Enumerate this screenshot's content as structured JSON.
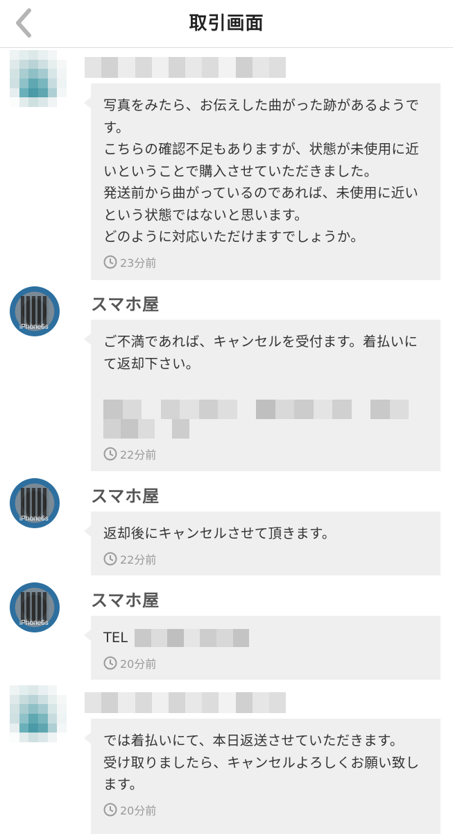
{
  "header": {
    "title": "取引画面",
    "back_icon": "chevron-left-icon"
  },
  "colors": {
    "bubble": "#efefef",
    "time": "#999999",
    "name": "#555555"
  },
  "messages": [
    {
      "sender": "",
      "text": "写真をみたら、お伝えした曲がった跡があるようです。\nこちらの確認不足もありますが、状態が未使用に近いということで購入させていただきました。\n発送前から曲がっているのであれば、未使用に近いという状態ではないと思います。\nどのように対応いただけますでしょうか。",
      "time": "23分前"
    },
    {
      "sender": "スマホ屋",
      "avatar_label": "iPhone6s",
      "text": "ご不満であれば、キャンセルを受付ます。着払いにて返却下さい。",
      "time": "22分前"
    },
    {
      "sender": "スマホ屋",
      "avatar_label": "iPhone6s",
      "text": "返却後にキャンセルさせて頂きます。",
      "time": "22分前"
    },
    {
      "sender": "スマホ屋",
      "avatar_label": "iPhone6s",
      "text": "TEL",
      "time": "20分前"
    },
    {
      "sender": "",
      "text": "では着払いにて、本日返送させていただきます。\n受け取りましたら、キャンセルよろしくお願い致します。",
      "time": "20分前"
    }
  ]
}
